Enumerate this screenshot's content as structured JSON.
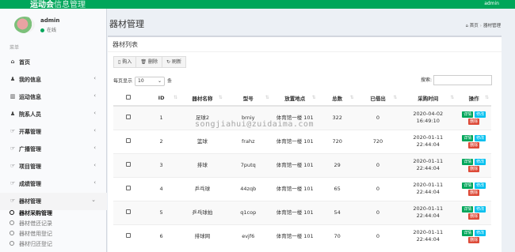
{
  "app": {
    "title": "运动会",
    "title_suffix": "信息管理",
    "user_label": "admin"
  },
  "user": {
    "name": "admin",
    "status": "在线"
  },
  "sidebar": {
    "header": "菜单",
    "items": [
      {
        "icon": "home-icon",
        "glyph": "⌂",
        "label": "首页"
      },
      {
        "icon": "user-icon",
        "glyph": "♟",
        "label": "我的信息"
      },
      {
        "icon": "bar-chart-icon",
        "glyph": "▥",
        "label": "运动信息"
      },
      {
        "icon": "users-icon",
        "glyph": "♟",
        "label": "院系人员"
      },
      {
        "icon": "hand-icon",
        "glyph": "☞",
        "label": "开幕管理"
      },
      {
        "icon": "hand-icon",
        "glyph": "☞",
        "label": "广播管理"
      },
      {
        "icon": "hand-icon",
        "glyph": "☞",
        "label": "项目管理"
      },
      {
        "icon": "hand-icon",
        "glyph": "☞",
        "label": "成绩管理"
      },
      {
        "icon": "hand-icon",
        "glyph": "☞",
        "label": "器材管理"
      }
    ],
    "subitems": [
      "器材采购管理",
      "器材借还记录",
      "器材借用登记",
      "器材归还登记"
    ]
  },
  "page": {
    "title": "器材管理",
    "breadcrumb": [
      "首页",
      "器材管理"
    ]
  },
  "box": {
    "title": "器材列表",
    "toolbar": [
      "购入",
      "删除",
      "刷新"
    ],
    "length_prefix": "每页显示",
    "length_value": "10",
    "length_suffix": "条",
    "search_label": "搜索:"
  },
  "table": {
    "headers": [
      "ID",
      "器材名称",
      "型号",
      "放置地点",
      "总数",
      "已借出",
      "采购时间",
      "操作"
    ],
    "rows": [
      {
        "id": "1",
        "name": "足球2",
        "model": "brniy",
        "place": "体育馆一楼 101",
        "total": "322",
        "lent": "0",
        "date": "2020-04-02",
        "time": "16:49:10"
      },
      {
        "id": "2",
        "name": "篮球",
        "model": "frahz",
        "place": "体育馆一楼 101",
        "total": "720",
        "lent": "720",
        "date": "2020-01-11",
        "time": "22:44:04"
      },
      {
        "id": "3",
        "name": "排球",
        "model": "7putq",
        "place": "体育馆一楼 101",
        "total": "29",
        "lent": "0",
        "date": "2020-01-11",
        "time": "22:44:04"
      },
      {
        "id": "4",
        "name": "乒乓球",
        "model": "44zqb",
        "place": "体育馆一楼 101",
        "total": "65",
        "lent": "0",
        "date": "2020-01-11",
        "time": "22:44:04"
      },
      {
        "id": "5",
        "name": "乒乓球拍",
        "model": "q1cop",
        "place": "体育馆一楼 101",
        "total": "54",
        "lent": "0",
        "date": "2020-01-11",
        "time": "22:44:04"
      },
      {
        "id": "6",
        "name": "排球网",
        "model": "evjf6",
        "place": "体育馆一楼 101",
        "total": "70",
        "lent": "0",
        "date": "2020-01-11",
        "time": "22:44:04"
      }
    ],
    "action_labels": {
      "detail": "详情",
      "edit": "修改",
      "delete": "删除"
    }
  },
  "watermark": "songjiahui@zuidaima.com",
  "colors": {
    "header": "#00a65a",
    "detail": "#00a65a",
    "edit": "#00c0ef",
    "delete": "#dd4b39"
  }
}
